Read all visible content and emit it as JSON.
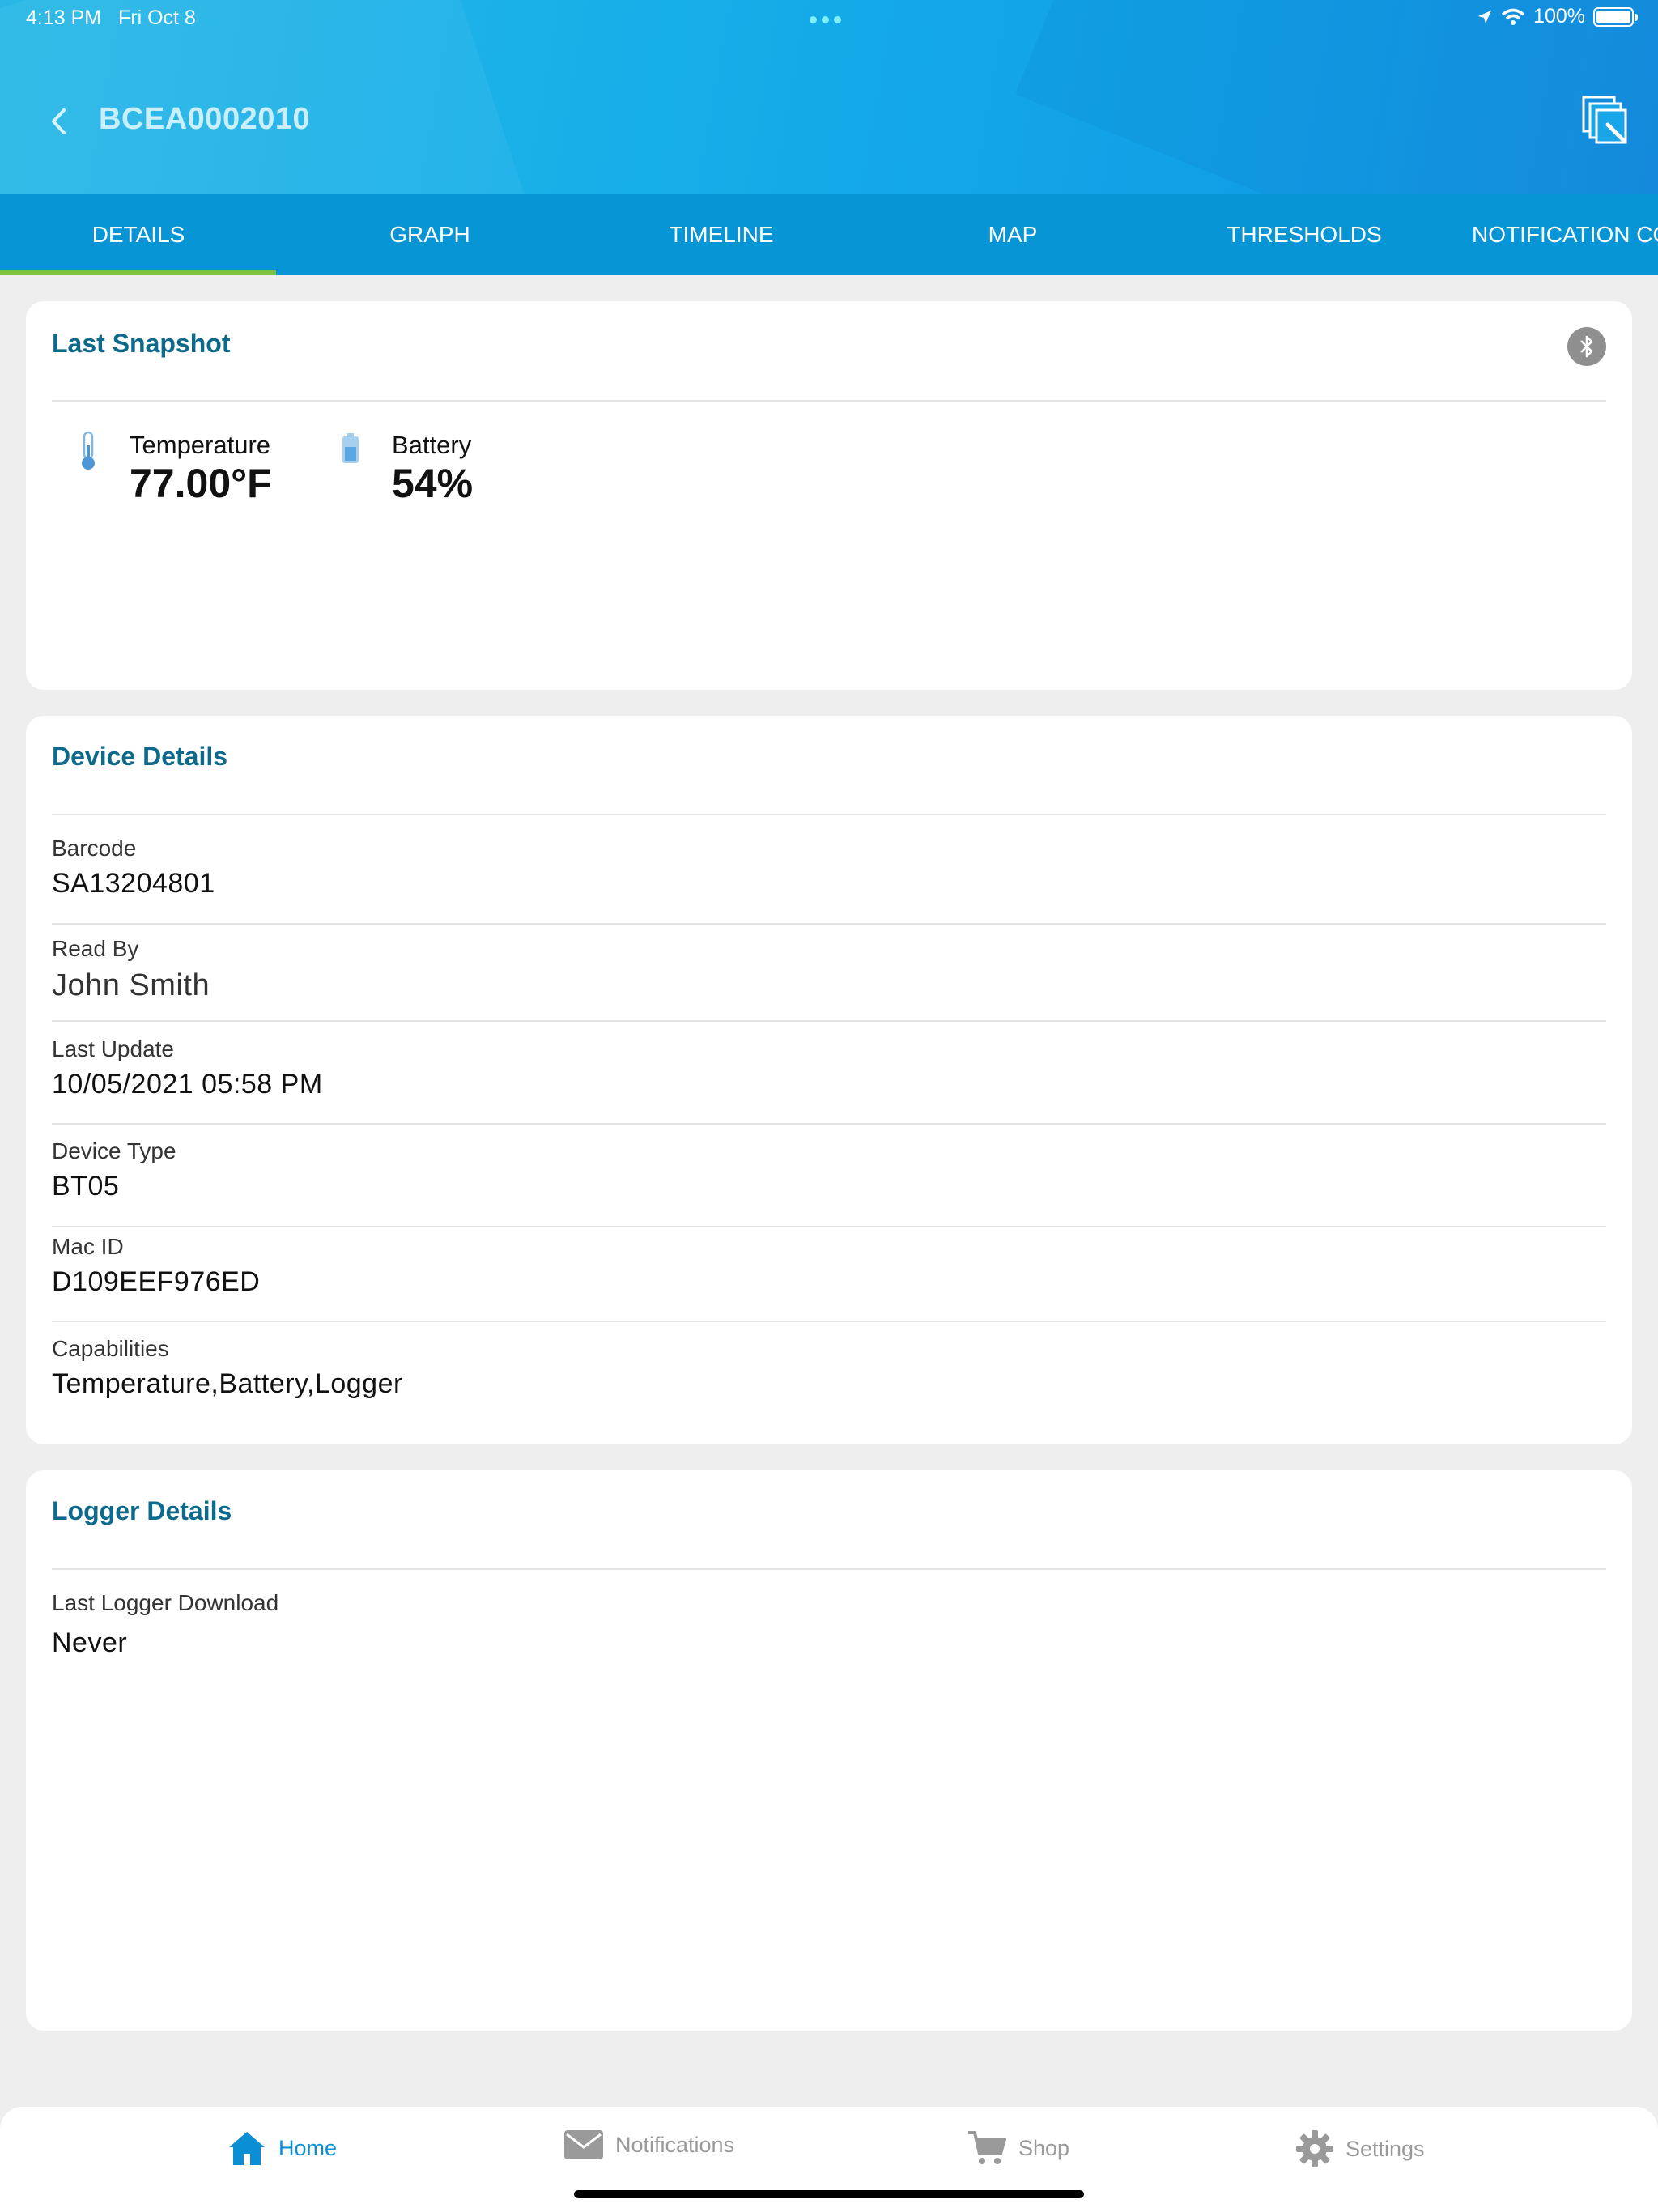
{
  "status_bar": {
    "time": "4:13 PM",
    "date": "Fri Oct 8",
    "battery": "100%"
  },
  "header": {
    "title": "BCEA0002010"
  },
  "tabs": [
    {
      "label": "DETAILS",
      "active": true
    },
    {
      "label": "GRAPH"
    },
    {
      "label": "TIMELINE"
    },
    {
      "label": "MAP"
    },
    {
      "label": "THRESHOLDS"
    },
    {
      "label": "NOTIFICATION CONTACTS"
    }
  ],
  "snapshot": {
    "title": "Last Snapshot",
    "temperature": {
      "label": "Temperature",
      "value": "77.00°F"
    },
    "battery": {
      "label": "Battery",
      "value": "54%"
    }
  },
  "device_details": {
    "title": "Device Details",
    "fields": [
      {
        "label": "Barcode",
        "value": "SA13204801"
      },
      {
        "label": "Read By",
        "value": "John Smith"
      },
      {
        "label": "Last Update",
        "value": "10/05/2021 05:58 PM"
      },
      {
        "label": "Device Type",
        "value": "BT05"
      },
      {
        "label": "Mac ID",
        "value": "D109EEF976ED"
      },
      {
        "label": "Capabilities",
        "value": "Temperature,Battery,Logger"
      }
    ]
  },
  "logger_details": {
    "title": "Logger Details",
    "fields": [
      {
        "label": "Last Logger Download",
        "value": "Never"
      }
    ]
  },
  "bottom_nav": [
    {
      "label": "Home",
      "icon": "home-icon",
      "active": true
    },
    {
      "label": "Notifications",
      "icon": "envelope-icon"
    },
    {
      "label": "Shop",
      "icon": "cart-icon"
    },
    {
      "label": "Settings",
      "icon": "gear-icon"
    }
  ],
  "colors": {
    "header_gradient_start": "#29b8e6",
    "header_gradient_end": "#1790e2",
    "tab_bar": "#0895d6",
    "tab_indicator": "#7cc243",
    "card_title": "#0e6a8a",
    "active_nav": "#0a8fd4",
    "inactive_nav": "#9a9a9a"
  }
}
